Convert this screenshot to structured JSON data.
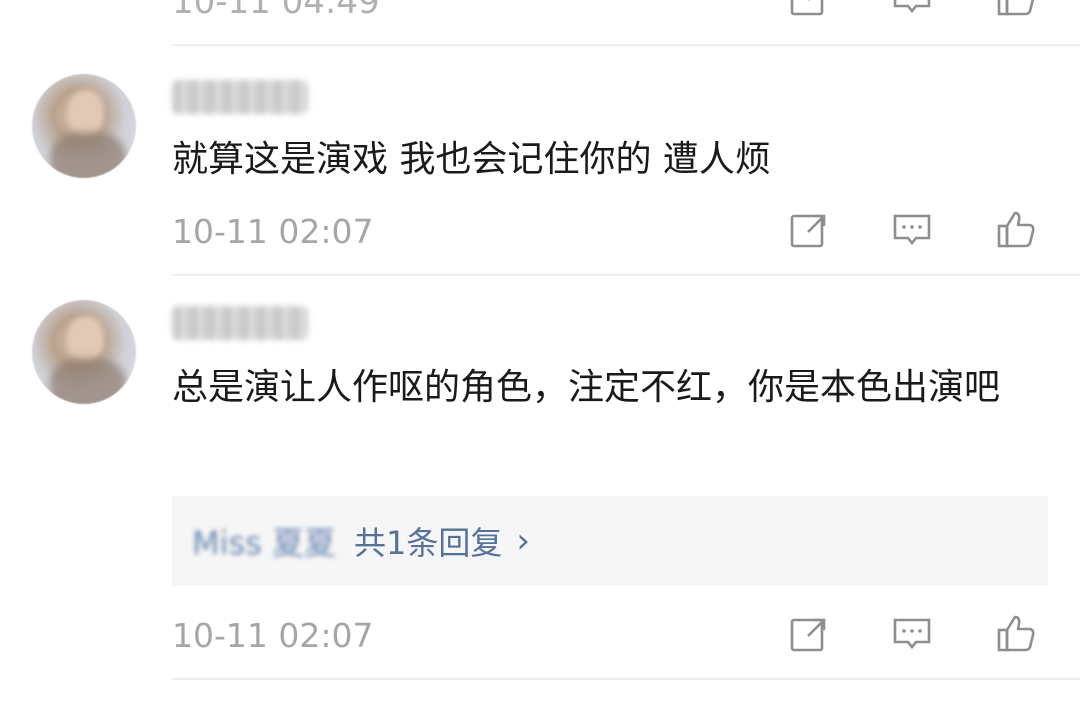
{
  "top_item": {
    "time": "10-11 04:49"
  },
  "comments": [
    {
      "username": "",
      "content": "就算这是演戏 我也会记住你的 遭人烦",
      "time": "10-11 02:07"
    },
    {
      "username": "",
      "content": "总是演让人作呕的角色，注定不红，你是本色出演吧",
      "reply": {
        "user": "Miss 夏夏",
        "count_label": "共1条回复",
        "arrow": "›"
      },
      "time": "10-11 02:07"
    }
  ],
  "icons": [
    "share-icon",
    "comment-icon",
    "like-icon"
  ],
  "colors": {
    "time": "#a6a6a6",
    "reply_link": "#55729a",
    "divider": "#eeeeee",
    "reply_bg": "#f6f6f6"
  }
}
